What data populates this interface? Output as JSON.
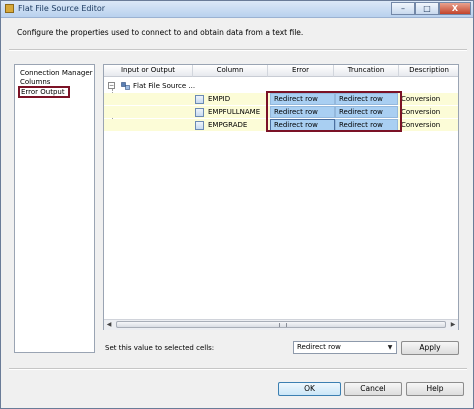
{
  "window": {
    "title": "Flat File Source Editor",
    "controls": {
      "minimize": "–",
      "maximize": "□",
      "close": "X"
    }
  },
  "description": "Configure the properties used to connect to and obtain data from a text file.",
  "nav": {
    "items": [
      {
        "label": "Connection Manager"
      },
      {
        "label": "Columns"
      },
      {
        "label": "Error Output",
        "selected": true
      }
    ]
  },
  "grid": {
    "headers": [
      "Input or Output",
      "Column",
      "Error",
      "Truncation",
      "Description"
    ],
    "source_node": "Flat File Source ...",
    "tree_toggle": "−",
    "rows": [
      {
        "column": "EMPID",
        "error": "Redirect row",
        "truncation": "Redirect row",
        "description": "Conversion"
      },
      {
        "column": "EMPFULLNAME",
        "error": "Redirect row",
        "truncation": "Redirect row",
        "description": "Conversion"
      },
      {
        "column": "EMPGRADE",
        "error": "Redirect row",
        "truncation": "Redirect row",
        "description": "Conversion"
      }
    ],
    "scroll": {
      "left": "◀",
      "right": "▶"
    }
  },
  "set_value": {
    "label": "Set this value to selected cells:",
    "selected": "Redirect row",
    "apply_label": "Apply"
  },
  "footer": {
    "ok_label": "OK",
    "cancel_label": "Cancel",
    "help_label": "Help"
  },
  "colors": {
    "highlight_border": "#7b1226",
    "selected_cell": "#a9cff2",
    "row_background": "#fcfcd7"
  }
}
